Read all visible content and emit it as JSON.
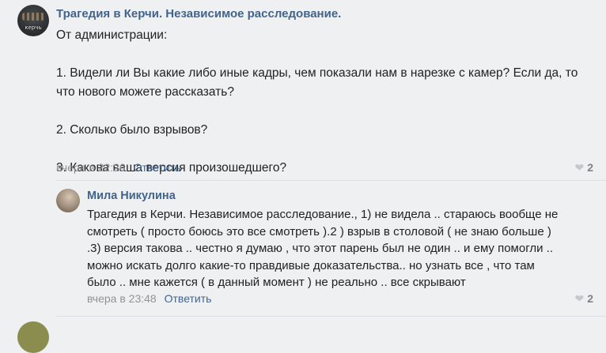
{
  "main_comment": {
    "author": "Трагедия в Керчи. Независимое расследование.",
    "avatar_caption": "керчь",
    "lines": [
      "От администрации:",
      "",
      "1. Видели ли Вы какие либо иные кадры, чем показали нам в нарезке с камер? Если да, то",
      "что нового можете рассказать?",
      "",
      "2. Сколько было взрывов?",
      "",
      "3. Какова ваша версия произошедшего?"
    ],
    "time": "вчера в 22:26",
    "reply_label": "Ответить",
    "likes": "2"
  },
  "reply_comment": {
    "author": "Мила Никулина",
    "lines": [
      "Трагедия в Керчи. Независимое расследование., 1) не видела .. стараюсь вообще не",
      "смотреть ( просто боюсь это все смотреть ).2 ) взрыв в столовой ( не знаю больше )",
      ".3) версия такова .. честно я думаю , что этот парень был не один .. и ему помогли ..",
      "можно искать долго какие-то правдивые доказательства.. но узнать все , что там",
      "было .. мне кажется ( в данный момент ) не реально .. все скрывают"
    ],
    "time": "вчера в 23:48",
    "reply_label": "Ответить",
    "likes": "2"
  },
  "icons": {
    "like": "heart-icon"
  },
  "colors": {
    "link": "#42648b",
    "meta": "#939393",
    "background": "#eef0f2"
  }
}
